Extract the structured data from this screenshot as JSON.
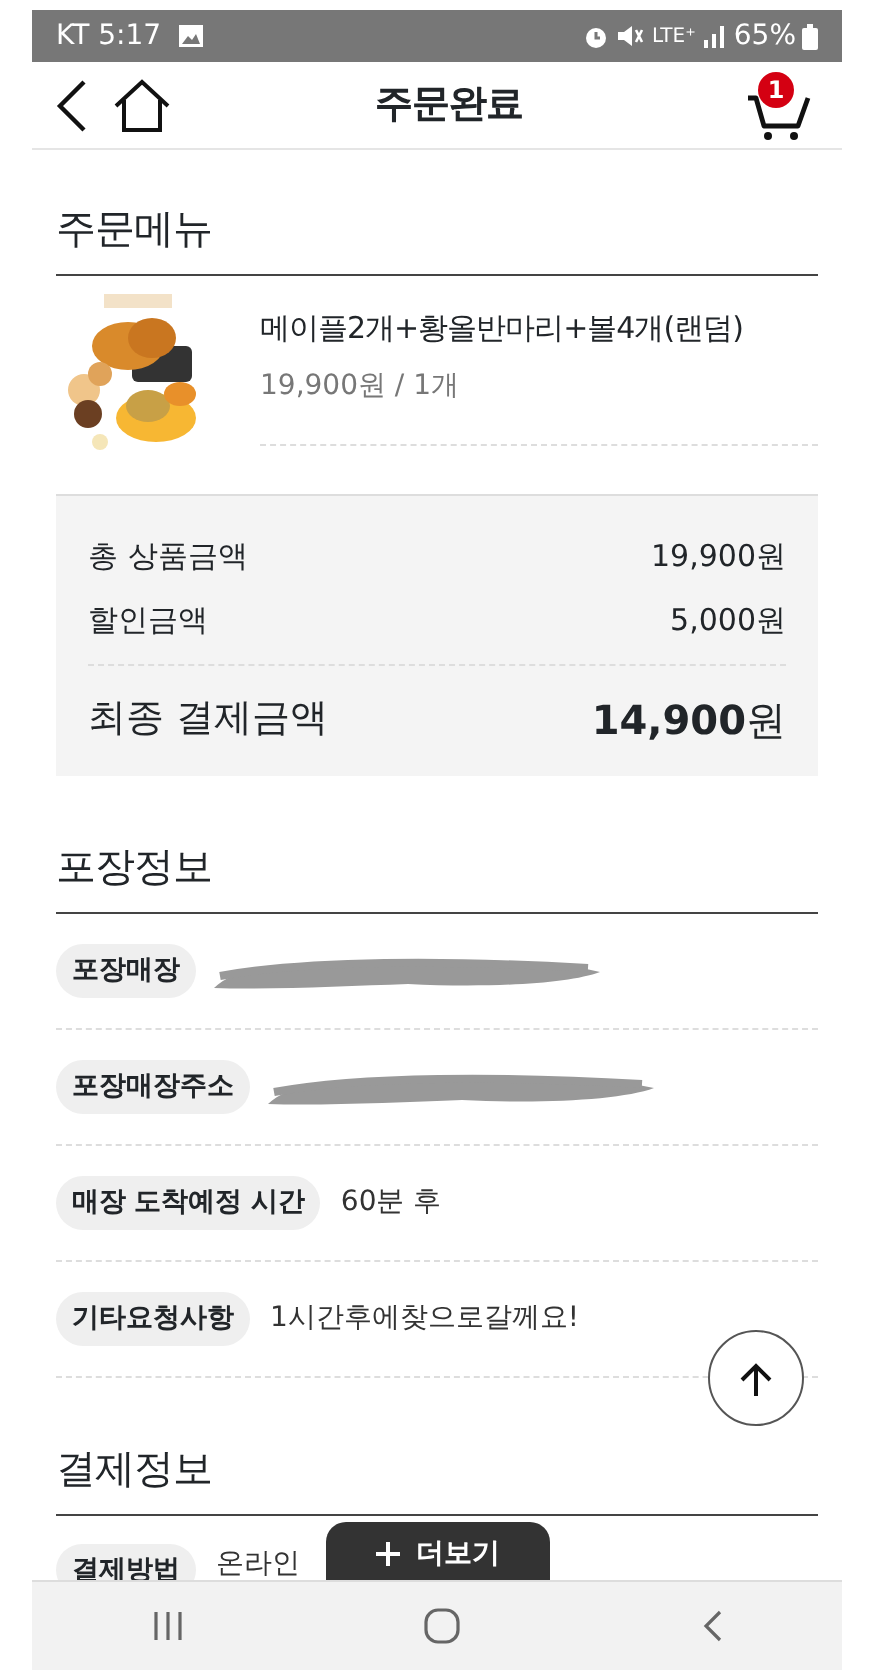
{
  "status_bar": {
    "carrier_time": "KT 5:17",
    "network": "LTE⁺",
    "battery": "65%"
  },
  "header": {
    "title": "주문완료",
    "cart_count": "1"
  },
  "order_menu": {
    "heading": "주문메뉴",
    "items": [
      {
        "kind": "picture",
        "name": "메이플2개+황올반마리+볼4개(랜덤)",
        "price": "19,900원 / 1개"
      }
    ],
    "summary": [
      {
        "kind": "normal",
        "label": "총 상품금액",
        "value": "19,900원"
      },
      {
        "kind": "normal",
        "label": "할인금액",
        "value": "5,000원"
      },
      {
        "kind": "total",
        "label": "최종 결제금액",
        "value": "**14,900**원"
      }
    ]
  },
  "pickup_info": {
    "heading": "포장정보",
    "rows": [
      {
        "kind": "redacted",
        "label": "포장매장"
      },
      {
        "kind": "redacted",
        "label": "포장매장주소"
      },
      {
        "kind": "text",
        "label": "매장 도착예정 시간",
        "value": "60분 후"
      },
      {
        "kind": "text",
        "label": "기타요청사항",
        "value": "1시간후에찾으로갈께요!"
      }
    ]
  },
  "payment_info": {
    "heading": "결제정보",
    "rows": [
      {
        "kind": "text",
        "label": "결제방법",
        "value": "온라인"
      }
    ]
  },
  "more_button": {
    "label": "더보기"
  }
}
